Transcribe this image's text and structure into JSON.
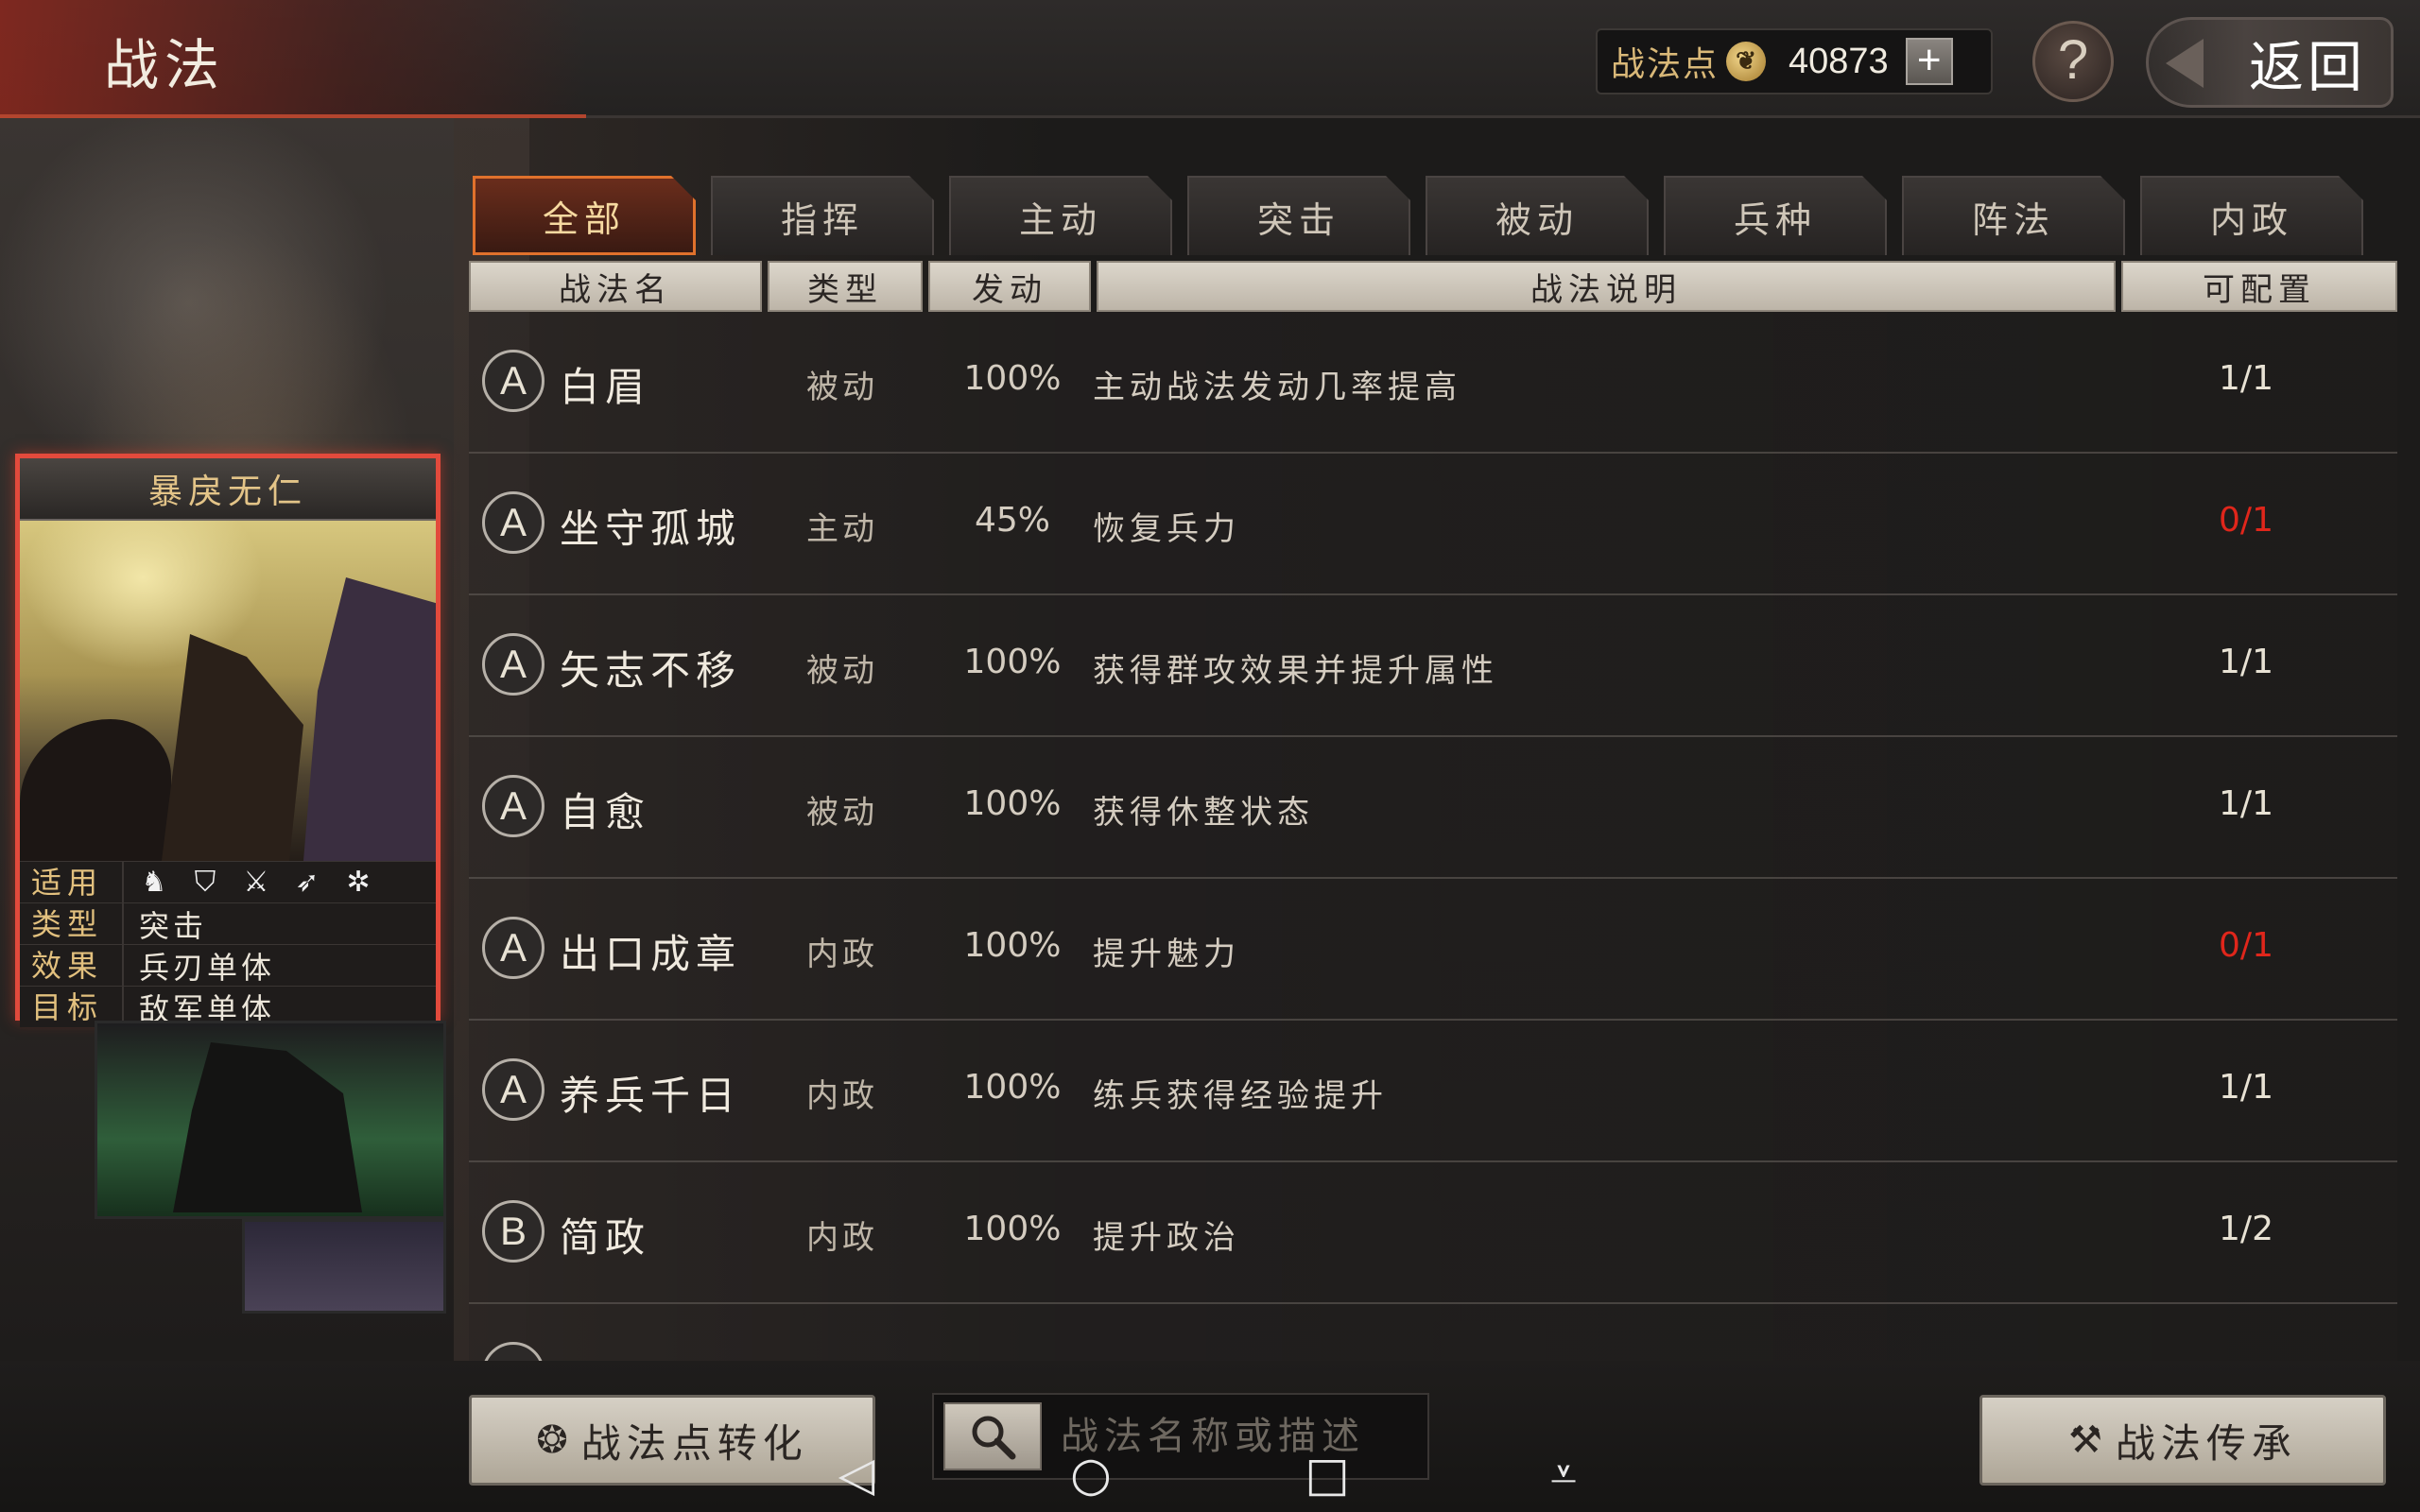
{
  "header": {
    "title": "战法",
    "points_label": "战法点",
    "points_value": "40873",
    "plus_label": "+",
    "help_label": "?",
    "back_label": "返回"
  },
  "tabs": [
    {
      "label": "全部",
      "active": true
    },
    {
      "label": "指挥",
      "active": false
    },
    {
      "label": "主动",
      "active": false
    },
    {
      "label": "突击",
      "active": false
    },
    {
      "label": "被动",
      "active": false
    },
    {
      "label": "兵种",
      "active": false
    },
    {
      "label": "阵法",
      "active": false
    },
    {
      "label": "内政",
      "active": false
    }
  ],
  "columns": {
    "name": "战法名",
    "type": "类型",
    "trigger": "发动",
    "desc": "战法说明",
    "slots": "可配置"
  },
  "skills": [
    {
      "grade": "A",
      "name": "白眉",
      "type": "被动",
      "rate": "100%",
      "desc": "主动战法发动几率提高",
      "count": "1/1",
      "red": false
    },
    {
      "grade": "A",
      "name": "坐守孤城",
      "type": "主动",
      "rate": "45%",
      "desc": "恢复兵力",
      "count": "0/1",
      "red": true
    },
    {
      "grade": "A",
      "name": "矢志不移",
      "type": "被动",
      "rate": "100%",
      "desc": "获得群攻效果并提升属性",
      "count": "1/1",
      "red": false
    },
    {
      "grade": "A",
      "name": "自愈",
      "type": "被动",
      "rate": "100%",
      "desc": "获得休整状态",
      "count": "1/1",
      "red": false
    },
    {
      "grade": "A",
      "name": "出口成章",
      "type": "内政",
      "rate": "100%",
      "desc": "提升魅力",
      "count": "0/1",
      "red": true
    },
    {
      "grade": "A",
      "name": "养兵千日",
      "type": "内政",
      "rate": "100%",
      "desc": "练兵获得经验提升",
      "count": "1/1",
      "red": false
    },
    {
      "grade": "B",
      "name": "简政",
      "type": "内政",
      "rate": "100%",
      "desc": "提升政治",
      "count": "1/2",
      "red": false
    }
  ],
  "card": {
    "title": "暴戾无仁",
    "applicable_label": "适用",
    "applicable_icons": [
      "cavalry-icon",
      "shield-icon",
      "crossed-swords-icon",
      "archer-icon",
      "siege-icon"
    ],
    "type_label": "类型",
    "type_value": "突击",
    "effect_label": "效果",
    "effect_value": "兵刃单体",
    "target_label": "目标",
    "target_value": "敌军单体"
  },
  "footer": {
    "convert_label": "战法点转化",
    "search_placeholder": "战法名称或描述",
    "inherit_label": "战法传承"
  },
  "colors": {
    "active_tab_border": "#e0712c",
    "card_border": "#e24a3c",
    "count_red": "#e0261b",
    "gold_text": "#e2c07e"
  }
}
